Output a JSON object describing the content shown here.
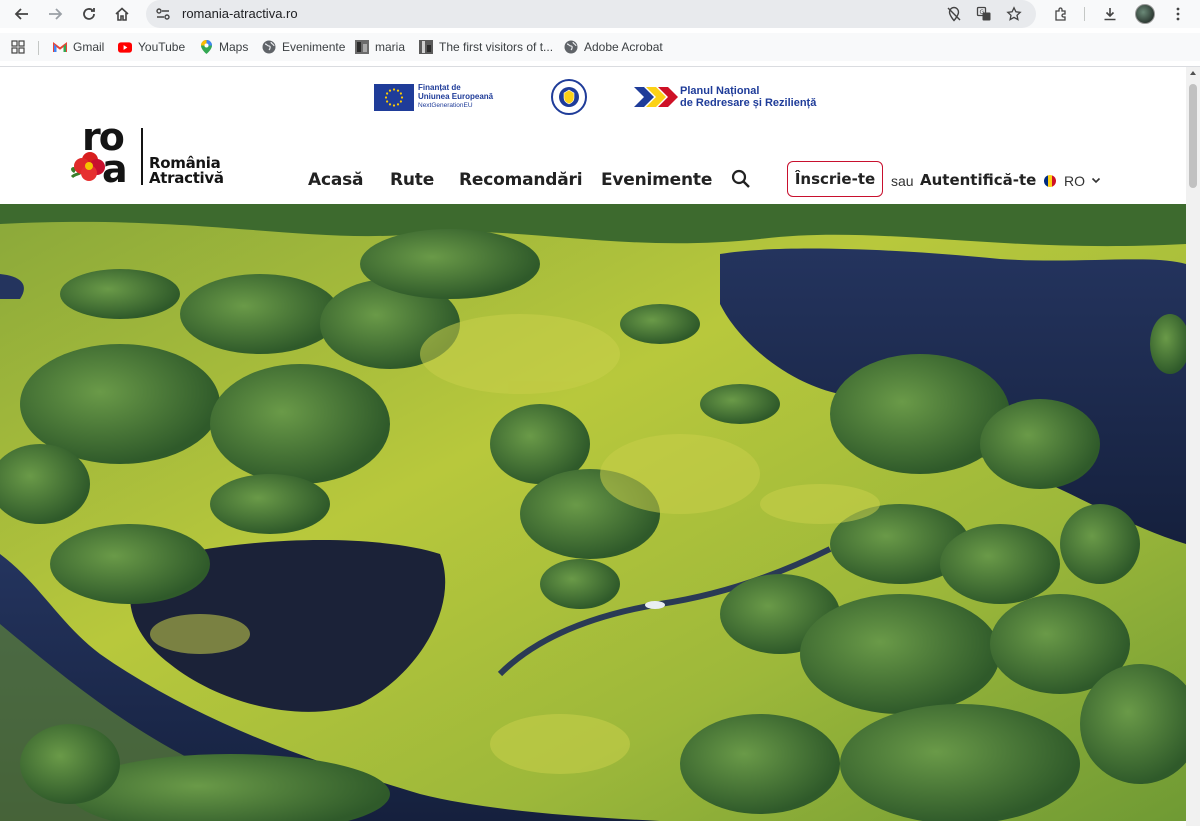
{
  "browser": {
    "url": "romania-atractiva.ro",
    "bookmarks": [
      {
        "label": "Gmail",
        "icon": "gmail-icon"
      },
      {
        "label": "YouTube",
        "icon": "youtube-icon"
      },
      {
        "label": "Maps",
        "icon": "maps-icon"
      },
      {
        "label": "Evenimente",
        "icon": "globe-icon"
      },
      {
        "label": "maria",
        "icon": "page-thumbnail-icon"
      },
      {
        "label": "The first visitors of t...",
        "icon": "page-thumbnail-icon"
      },
      {
        "label": "Adobe Acrobat",
        "icon": "globe-icon"
      }
    ]
  },
  "funding": {
    "eu_line1": "Finanțat de",
    "eu_line2": "Uniunea Europeană",
    "eu_line3": "NextGenerationEU",
    "pnrr_line1": "Planul Național",
    "pnrr_line2": "de Redresare și Reziliență"
  },
  "site": {
    "logo_ro": "ro",
    "logo_a": "a",
    "name_line1": "România",
    "name_line2": "Atractivă"
  },
  "nav": {
    "items": [
      "Acasă",
      "Rute",
      "Recomandări",
      "Evenimente"
    ],
    "signup": "Înscrie-te",
    "or": "sau",
    "login": "Autentifică-te",
    "language": "RO"
  },
  "colors": {
    "brand_red": "#c8102e",
    "eu_blue": "#1f3c99",
    "ro_flag": [
      "#002b7f",
      "#fcd116",
      "#ce1126"
    ]
  }
}
